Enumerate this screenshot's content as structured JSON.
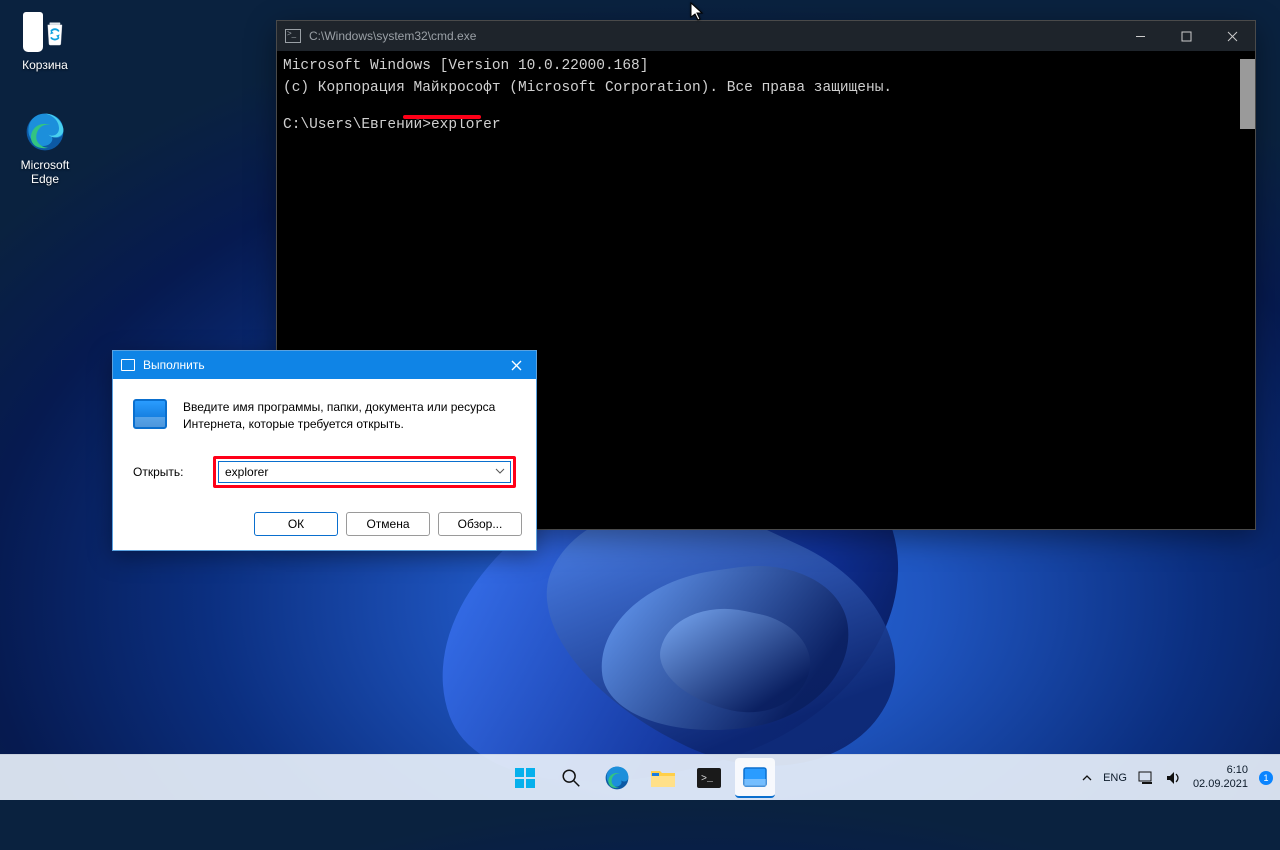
{
  "desktop": {
    "icons": {
      "recycle_bin": "Корзина",
      "edge": "Microsoft Edge"
    }
  },
  "cmd": {
    "title": "C:\\Windows\\system32\\cmd.exe",
    "line1": "Microsoft Windows [Version 10.0.22000.168]",
    "line2": "(c) Корпорация Майкрософт (Microsoft Corporation). Все права защищены.",
    "prompt": "C:\\Users\\Евгений>",
    "command": "explorer"
  },
  "run": {
    "title": "Выполнить",
    "instruction": "Введите имя программы, папки, документа или ресурса Интернета, которые требуется открыть.",
    "open_label": "Открыть:",
    "input_value": "explorer",
    "btn_ok": "ОК",
    "btn_cancel": "Отмена",
    "btn_browse": "Обзор..."
  },
  "taskbar": {
    "lang": "ENG",
    "time": "6:10",
    "date": "02.09.2021"
  }
}
